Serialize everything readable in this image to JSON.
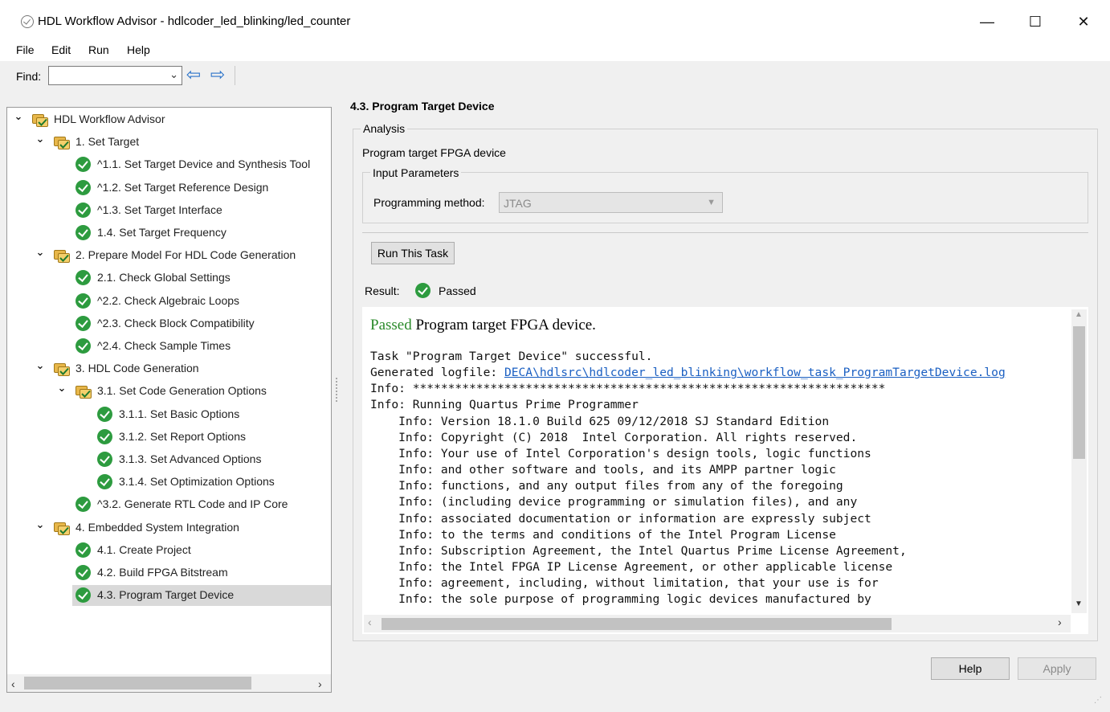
{
  "window": {
    "title": "HDL Workflow Advisor - hdlcoder_led_blinking/led_counter",
    "minimize": "—",
    "maximize": "☐",
    "close": "✕"
  },
  "menu": {
    "file": "File",
    "edit": "Edit",
    "run": "Run",
    "help": "Help"
  },
  "find": {
    "label": "Find:",
    "value": "",
    "back_icon": "⇦",
    "forward_icon": "⇨"
  },
  "tree": {
    "items": [
      {
        "label": "HDL Workflow Advisor",
        "icon": "folder",
        "toggle": "expanded"
      },
      {
        "label": "1. Set Target",
        "icon": "folder",
        "toggle": "expanded"
      },
      {
        "label": "^1.1. Set Target Device and Synthesis Tool",
        "icon": "check"
      },
      {
        "label": "^1.2. Set Target Reference Design",
        "icon": "check"
      },
      {
        "label": "^1.3. Set Target Interface",
        "icon": "check"
      },
      {
        "label": "1.4. Set Target Frequency",
        "icon": "check"
      },
      {
        "label": "2. Prepare Model For HDL Code Generation",
        "icon": "folder",
        "toggle": "expanded"
      },
      {
        "label": "2.1. Check Global Settings",
        "icon": "check"
      },
      {
        "label": "^2.2. Check Algebraic Loops",
        "icon": "check"
      },
      {
        "label": "^2.3. Check Block Compatibility",
        "icon": "check"
      },
      {
        "label": "^2.4. Check Sample Times",
        "icon": "check"
      },
      {
        "label": "3. HDL Code Generation",
        "icon": "folder",
        "toggle": "expanded"
      },
      {
        "label": "3.1. Set Code Generation Options",
        "icon": "folder",
        "toggle": "expanded"
      },
      {
        "label": "3.1.1. Set Basic Options",
        "icon": "check"
      },
      {
        "label": "3.1.2. Set Report Options",
        "icon": "check"
      },
      {
        "label": "3.1.3. Set Advanced Options",
        "icon": "check"
      },
      {
        "label": "3.1.4. Set Optimization Options",
        "icon": "check"
      },
      {
        "label": "^3.2. Generate RTL Code and IP Core",
        "icon": "check"
      },
      {
        "label": "4. Embedded System Integration",
        "icon": "folder",
        "toggle": "expanded"
      },
      {
        "label": "4.1. Create Project",
        "icon": "check"
      },
      {
        "label": "4.2. Build FPGA Bitstream",
        "icon": "check"
      },
      {
        "label": "4.3. Program Target Device",
        "icon": "check",
        "selected": true
      }
    ]
  },
  "task": {
    "title": "4.3. Program Target Device",
    "analysis_legend": "Analysis",
    "description": "Program target FPGA device",
    "input_params_legend": "Input Parameters",
    "prog_method_label": "Programming method:",
    "prog_method_value": "JTAG",
    "run_button": "Run This Task",
    "result_label": "Result:",
    "result_value": "Passed"
  },
  "report": {
    "heading_status": "Passed",
    "heading_text": " Program target FPGA device.",
    "line_task": "Task \"Program Target Device\" successful.",
    "line_logfile_prefix": "Generated logfile: ",
    "logfile_link": "DECA\\hdlsrc\\hdlcoder_led_blinking\\workflow_task_ProgramTargetDevice.log",
    "lines": [
      "Info: *******************************************************************",
      "Info: Running Quartus Prime Programmer",
      "    Info: Version 18.1.0 Build 625 09/12/2018 SJ Standard Edition",
      "    Info: Copyright (C) 2018  Intel Corporation. All rights reserved.",
      "    Info: Your use of Intel Corporation's design tools, logic functions",
      "    Info: and other software and tools, and its AMPP partner logic",
      "    Info: functions, and any output files from any of the foregoing",
      "    Info: (including device programming or simulation files), and any",
      "    Info: associated documentation or information are expressly subject",
      "    Info: to the terms and conditions of the Intel Program License",
      "    Info: Subscription Agreement, the Intel Quartus Prime License Agreement,",
      "    Info: the Intel FPGA IP License Agreement, or other applicable license",
      "    Info: agreement, including, without limitation, that your use is for",
      "    Info: the sole purpose of programming logic devices manufactured by"
    ]
  },
  "buttons": {
    "help": "Help",
    "apply": "Apply"
  },
  "colors": {
    "passed_green": "#2d9b3f",
    "link_blue": "#1a5fc2",
    "folder_yellow": "#e8b74a"
  }
}
